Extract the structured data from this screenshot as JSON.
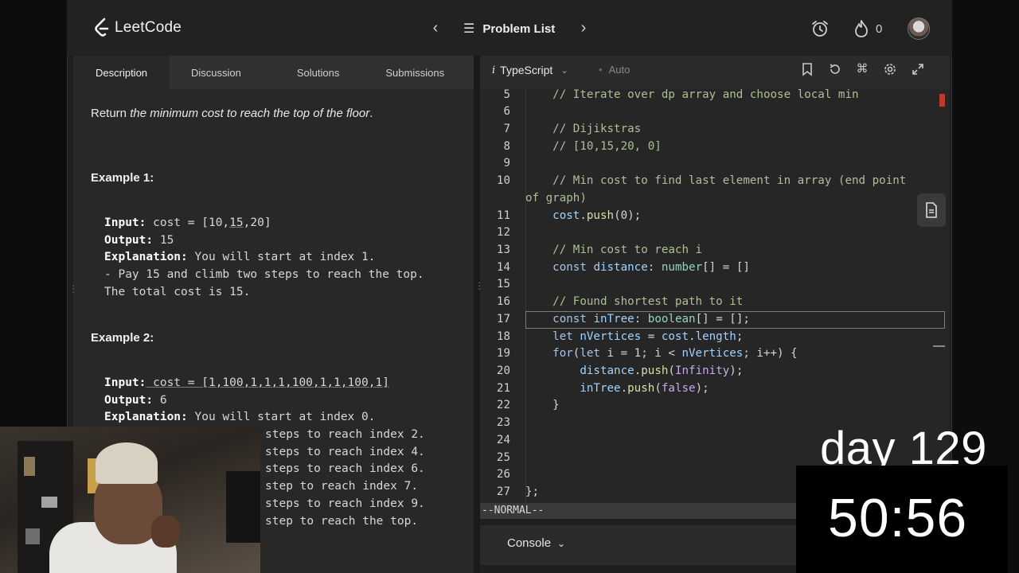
{
  "app": {
    "name": "LeetCode"
  },
  "topbar": {
    "problem_list_label": "Problem List",
    "streak_count": "0"
  },
  "tabs": [
    "Description",
    "Discussion",
    "Solutions",
    "Submissions"
  ],
  "description": {
    "return_prefix": "Return ",
    "return_italic": "the minimum cost to reach the top of the floor",
    "return_suffix": ".",
    "example1_title": "Example 1:",
    "example1": {
      "input_label": "Input:",
      "input_prefix": " cost = [10,",
      "input_underlined": "15",
      "input_suffix": ",20]",
      "output_label": "Output:",
      "output_value": " 15",
      "explanation_label": "Explanation:",
      "explanation_value": " You will start at index 1.",
      "line4": "- Pay 15 and climb two steps to reach the top.",
      "line5": "The total cost is 15."
    },
    "example2_title": "Example 2:",
    "example2": {
      "input_label": "Input:",
      "input_value": " cost = [1,100,1,1,1,100,1,1,100,1]",
      "output_label": "Output:",
      "output_value": " 6",
      "explanation_label": "Explanation:",
      "explanation_value": " You will start at index 0.",
      "visible_lines": [
        "steps to reach index 2.",
        "steps to reach index 4.",
        "steps to reach index 6.",
        "step to reach index 7.",
        "steps to reach index 9.",
        "step to reach the top."
      ]
    }
  },
  "editor": {
    "language": "TypeScript",
    "mode": "Auto",
    "status": "--NORMAL--",
    "console_label": "Console",
    "active_line_number": 17,
    "lines": [
      {
        "n": "5",
        "text": "    // Iterate over dp array and choose local min"
      },
      {
        "n": "6",
        "text": ""
      },
      {
        "n": "7",
        "text": "    // Dijikstras"
      },
      {
        "n": "8",
        "text": "    // [10,15,20, 0]"
      },
      {
        "n": "9",
        "text": ""
      },
      {
        "n": "10",
        "text": "    // Min cost to find last element in array (end point"
      },
      {
        "n": "",
        "text": "of graph)"
      },
      {
        "n": "11",
        "text": "    cost.push(0);"
      },
      {
        "n": "12",
        "text": ""
      },
      {
        "n": "13",
        "text": "    // Min cost to reach i"
      },
      {
        "n": "14",
        "text": "    const distance: number[] = []"
      },
      {
        "n": "15",
        "text": ""
      },
      {
        "n": "16",
        "text": "    // Found shortest path to it"
      },
      {
        "n": "17",
        "text": "    const inTree: boolean[] = [];"
      },
      {
        "n": "18",
        "text": "    let nVertices = cost.length;"
      },
      {
        "n": "19",
        "text": "    for(let i = 1; i < nVertices; i++) {"
      },
      {
        "n": "20",
        "text": "        distance.push(Infinity);"
      },
      {
        "n": "21",
        "text": "        inTree.push(false);"
      },
      {
        "n": "22",
        "text": "    }"
      },
      {
        "n": "23",
        "text": ""
      },
      {
        "n": "24",
        "text": ""
      },
      {
        "n": "25",
        "text": ""
      },
      {
        "n": "26",
        "text": ""
      },
      {
        "n": "27",
        "text": "};"
      }
    ]
  },
  "overlay": {
    "day_label": "day 129",
    "timer": "50:56"
  }
}
